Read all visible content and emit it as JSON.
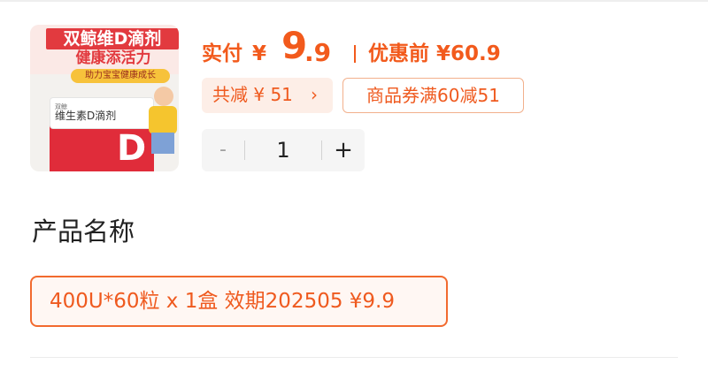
{
  "product": {
    "image": {
      "headline_1": "双鲸维D滴剂",
      "headline_2": "健康添活力",
      "tag": "助力宝宝健康成长",
      "brand": "双鲸",
      "product_name": "维生素D滴剂",
      "letter": "D"
    },
    "price": {
      "actual_label": "实付",
      "currency": "¥",
      "integer": "9",
      "decimal": ".9",
      "before_label": "优惠前 ¥60.9"
    },
    "discount": {
      "total_label": "共减 ¥ 51",
      "coupon_label": "商品券满60减51"
    },
    "quantity": {
      "minus": "-",
      "value": "1",
      "plus": "+"
    }
  },
  "section": {
    "title": "产品名称"
  },
  "options": [
    {
      "label": "400U*60粒 x 1盒 效期202505  ¥9.9",
      "selected": true
    }
  ],
  "colors": {
    "accent": "#f25a1c",
    "chip_bg": "#fdeee7",
    "chip_border": "#f2b08c"
  }
}
